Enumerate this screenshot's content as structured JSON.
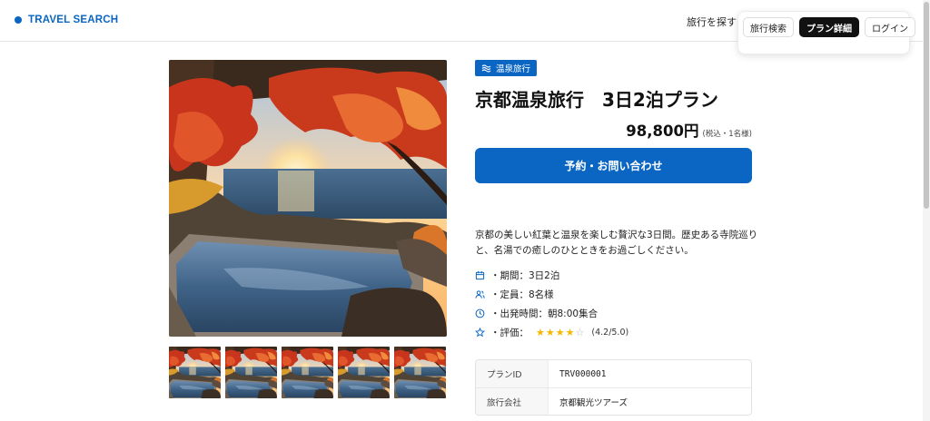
{
  "header": {
    "logo_text": "TRAVEL SEARCH",
    "nav_link": "旅行を探す",
    "menu": [
      {
        "label": "旅行検索",
        "active": false
      },
      {
        "label": "プラン詳細",
        "active": true
      },
      {
        "label": "ログイン",
        "active": false
      }
    ]
  },
  "plan": {
    "category_badge": "温泉旅行",
    "title": "京都温泉旅行　3日2泊プラン",
    "price": "98,800円",
    "price_note": "(税込・1名様)",
    "cta_label": "予約・お問い合わせ",
    "description": "京都の美しい紅葉と温泉を楽しむ贅沢な3日間。歴史ある寺院巡りと、名湯での癒しのひとときをお過ごしください。",
    "info": [
      {
        "icon": "calendar-icon",
        "text": "・期間：3日2泊"
      },
      {
        "icon": "people-icon",
        "text": "・定員：8名様"
      },
      {
        "icon": "clock-icon",
        "text": "・出発時間：朝8:00集合"
      }
    ],
    "rating": {
      "icon": "star-outline-icon",
      "label": "・評価：",
      "value": 4.2,
      "value_text": "(4.2/5.0)",
      "stars_full": 4,
      "stars_total": 5
    },
    "details": [
      {
        "key": "プランID",
        "value": "TRV000001"
      },
      {
        "key": "旅行会社",
        "value": "京都観光ツアーズ"
      }
    ]
  },
  "gallery": {
    "main_image": "autumn-onsen-ocean-sunset-photo",
    "thumbnail_count": 5
  },
  "colors": {
    "accent": "#0a66c2",
    "star": "#f5b800"
  }
}
